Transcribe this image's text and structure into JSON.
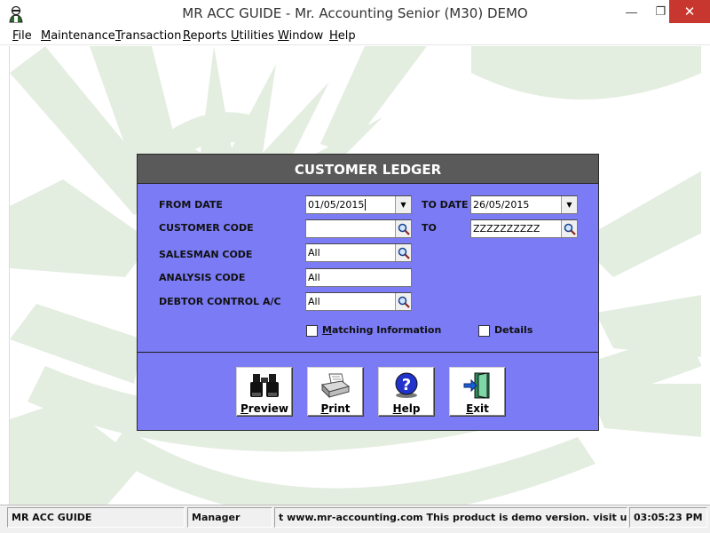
{
  "window": {
    "title": "MR ACC GUIDE - Mr. Accounting Senior (M30) DEMO",
    "min_glyph": "—",
    "max_glyph": "❐",
    "close_glyph": "✕"
  },
  "menu": {
    "items": [
      {
        "label": "File",
        "hotkey": "F",
        "rest": "ile"
      },
      {
        "label": "Maintenance",
        "hotkey": "M",
        "rest": "aintenance"
      },
      {
        "label": "Transaction",
        "hotkey": "T",
        "rest": "ransaction"
      },
      {
        "label": "Reports",
        "hotkey": "R",
        "rest": "eports"
      },
      {
        "label": "Utilities",
        "hotkey": "U",
        "rest": "tilities"
      },
      {
        "label": "Window",
        "hotkey": "W",
        "rest": "indow"
      },
      {
        "label": "Help",
        "hotkey": "H",
        "rest": "elp"
      }
    ]
  },
  "dialog": {
    "title": "CUSTOMER LEDGER",
    "labels": {
      "from_date": "FROM DATE",
      "to_date": "TO DATE",
      "customer_code": "CUSTOMER CODE",
      "to": "TO",
      "salesman_code": "SALESMAN CODE",
      "analysis_code": "ANALYSIS CODE",
      "debtor_control": "DEBTOR CONTROL A/C"
    },
    "fields": {
      "from_date": "01/05/2015",
      "to_date": "26/05/2015",
      "customer_from": "",
      "customer_to": "ZZZZZZZZZZ",
      "salesman": "All",
      "analysis": "All",
      "debtor_control": "All"
    },
    "checkboxes": {
      "matching_hotkey": "M",
      "matching_rest": "atching Information",
      "matching_checked": false,
      "details_label": "Details",
      "details_checked": false
    },
    "buttons": {
      "preview_hotkey": "P",
      "preview_rest": "review",
      "print_hotkey": "P",
      "print_rest": "rint",
      "help_hotkey": "H",
      "help_rest": "elp",
      "exit_hotkey": "E",
      "exit_rest": "xit"
    }
  },
  "status": {
    "company": "MR ACC GUIDE",
    "user": "Manager",
    "message": "t www.mr-accounting.com This product is demo version.  visit us a",
    "time": "03:05:23 PM"
  },
  "colors": {
    "dialog_body": "#7b7bf5",
    "dialog_header": "#5a5a5a",
    "close_button": "#c7372f",
    "wallpaper_green": "#e3ede0"
  }
}
